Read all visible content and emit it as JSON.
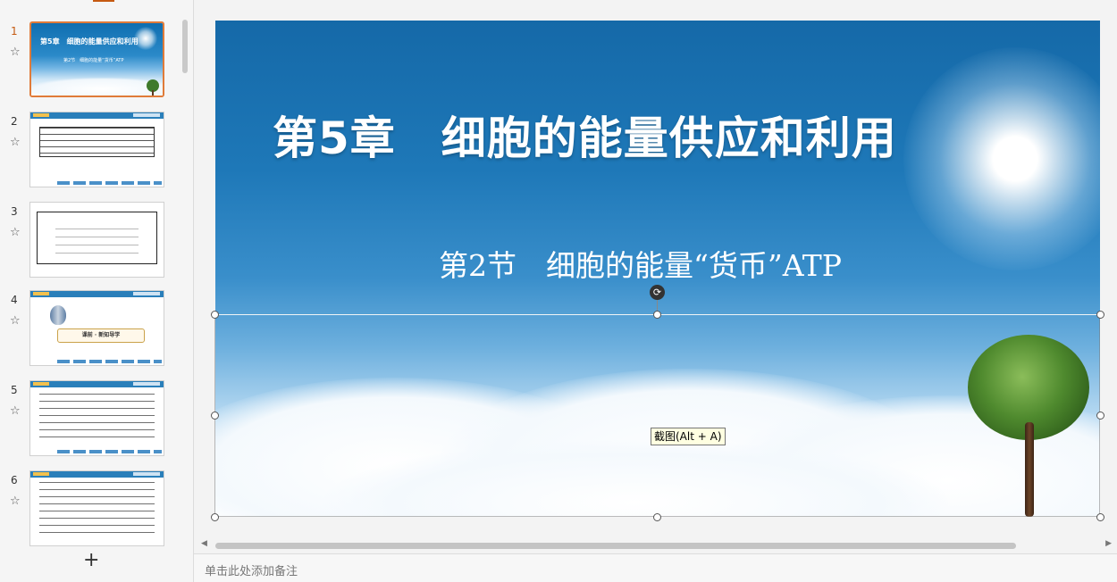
{
  "thumbnails": [
    {
      "number": "1",
      "title": "第5章　细胞的能量供应和利用",
      "subtitle": "第2节　细胞的能量“货币”ATP"
    },
    {
      "number": "2"
    },
    {
      "number": "3"
    },
    {
      "number": "4",
      "banner": "课前 · 新知导学"
    },
    {
      "number": "5"
    },
    {
      "number": "6"
    }
  ],
  "add_slide_icon": "+",
  "slide": {
    "chapter_title": "第5章　细胞的能量供应和利用",
    "section_title": "第2节　细胞的能量“货币”ATP"
  },
  "tooltip": "截图(Alt + A)",
  "notes_placeholder": "单击此处添加备注",
  "icons": {
    "star": "☆",
    "rotate": "⟳",
    "scroll_left": "◀",
    "scroll_right": "▶"
  },
  "colors": {
    "accent": "#e07b39",
    "slide_sky": "#1e78b8"
  }
}
